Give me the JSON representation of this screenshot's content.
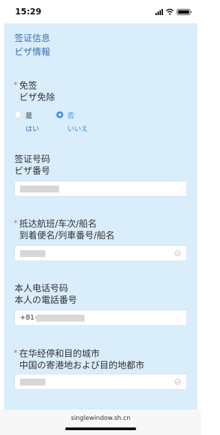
{
  "status_bar": {
    "time": "15:29",
    "icons": [
      "cellular-signal-icon",
      "wifi-icon",
      "battery-icon"
    ],
    "battery_level": 1.0
  },
  "section": {
    "title_cn": "签证信息",
    "title_jp": "ビザ情報"
  },
  "visa_exempt": {
    "label_cn": "免签",
    "label_jp": "ビザ免除",
    "required_mark": "*",
    "options": [
      {
        "label_cn": "是",
        "label_jp": "はい",
        "selected": false
      },
      {
        "label_cn": "否",
        "label_jp": "いいえ",
        "selected": true
      }
    ]
  },
  "visa_number": {
    "label_cn": "签证号码",
    "label_jp": "ビザ番号"
  },
  "arrival_flight": {
    "label_cn": "抵达航班/车次/船名",
    "label_jp": "到着便名/列車番号/船名",
    "required_mark": "*",
    "icon": "check-circle-icon"
  },
  "phone": {
    "label_cn": "本人电话号码",
    "label_jp": "本人の電話番号",
    "prefix": "+81-"
  },
  "stopover_city": {
    "label_cn": "在华经停和目的城市",
    "label_jp": "中国の寄港地および目的地都市",
    "required_mark": "*",
    "icon": "check-circle-icon"
  },
  "browser": {
    "url": "singlewindow.sh.cn"
  },
  "colors": {
    "panel_bg": "#d9edfb",
    "title_blue": "#3b6fb3",
    "required_red": "#e34d4d",
    "radio_selected": "#3d8fe8",
    "redaction_gray": "#d7d7d7"
  }
}
